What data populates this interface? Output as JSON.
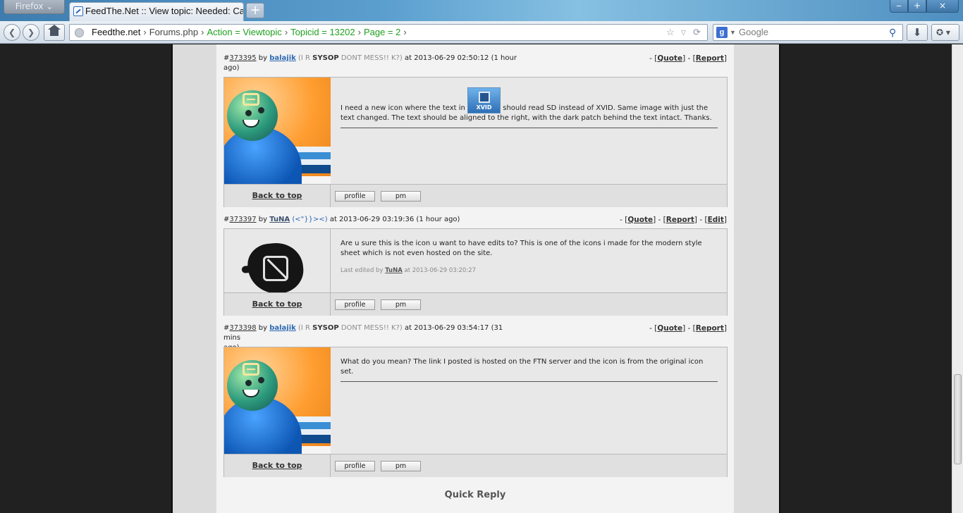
{
  "browser": {
    "menu_label": "Firefox",
    "tab_title": "FeedThe.Net :: View topic: Needed: Cate...",
    "newtab_symbol": "+",
    "window_controls": [
      "‒",
      "+",
      "×"
    ],
    "url_segments": [
      "Feedthe.net",
      "Forums.php",
      "Action = Viewtopic",
      "Topicid = 13202",
      "Page = 2"
    ],
    "search_placeholder": "Google",
    "search_engine_letter": "g"
  },
  "posts": [
    {
      "id": "373395",
      "by_label": "by",
      "author": "balajik",
      "title_pre": "(I R",
      "title_bold": "SYSOP",
      "title_post": "DONT MESS!! K?)",
      "timestamp": "at 2013-06-29 02:50:12 (1 hour",
      "timestamp_cont": "ago)",
      "actions": [
        "Quote",
        "Report"
      ],
      "body_before": "I need a new icon where the text in",
      "inline_icon_label": "XVID",
      "body_after": "should read SD instead of XVID. Same image with just the text changed. The text should be aligned to the right, with the dark patch behind the text intact. Thanks.",
      "back_to_top": "Back to top",
      "profile_label": "profile",
      "pm_label": "pm"
    },
    {
      "id": "373397",
      "by_label": "by",
      "author": "TuNA",
      "title_fish": "(<\"}}><)",
      "timestamp": "at 2013-06-29 03:19:36 (1 hour ago)",
      "actions": [
        "Quote",
        "Report",
        "Edit"
      ],
      "body": "Are u sure this is the icon u want to have edits to? This is one of the icons i made for the modern style sheet which is not even hosted on the site.",
      "edited_prefix": "Last edited by",
      "edited_by": "TuNA",
      "edited_at": "at 2013-06-29 03:20:27",
      "back_to_top": "Back to top",
      "profile_label": "profile",
      "pm_label": "pm"
    },
    {
      "id": "373398",
      "by_label": "by",
      "author": "balajik",
      "title_pre": "(I R",
      "title_bold": "SYSOP",
      "title_post": "DONT MESS!! K?)",
      "timestamp": "at 2013-06-29 03:54:17 (31 mins",
      "timestamp_cont": "ago)",
      "actions": [
        "Quote",
        "Report"
      ],
      "body": "What do you mean? The link I posted is hosted on the FTN server and the icon is from the original icon set.",
      "back_to_top": "Back to top",
      "profile_label": "profile",
      "pm_label": "pm"
    }
  ],
  "quick_reply": "Quick Reply"
}
